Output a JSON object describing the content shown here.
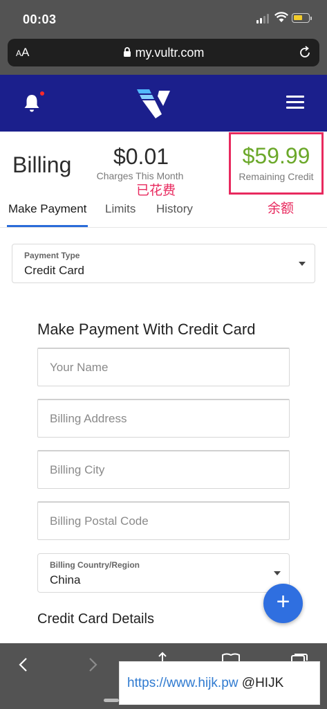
{
  "status_bar": {
    "time": "00:03"
  },
  "browser": {
    "text_size_label": "AA",
    "url": "my.vultr.com"
  },
  "billing": {
    "title": "Billing",
    "charges_amount": "$0.01",
    "charges_label": "Charges This Month",
    "charges_note": "已花费",
    "credit_amount": "$59.99",
    "credit_label": "Remaining Credit",
    "credit_note": "余额"
  },
  "tabs": [
    {
      "label": "Make Payment",
      "active": true
    },
    {
      "label": "Limits",
      "active": false
    },
    {
      "label": "History",
      "active": false
    }
  ],
  "payment_type": {
    "label": "Payment Type",
    "value": "Credit Card"
  },
  "form": {
    "heading": "Make Payment With Credit Card",
    "name_placeholder": "Your Name",
    "address_placeholder": "Billing Address",
    "city_placeholder": "Billing City",
    "postal_placeholder": "Billing Postal Code",
    "country_label": "Billing Country/Region",
    "country_value": "China",
    "cc_heading": "Credit Card Details"
  },
  "fab": {
    "symbol": "+"
  },
  "watermark": {
    "link": "https://www.hijk.pw",
    "handle": "@HIJK"
  },
  "colors": {
    "brand": "#1b1f8c",
    "accent": "#2f6fe0",
    "credit": "#6ba82a",
    "annotation": "#e8295e"
  }
}
